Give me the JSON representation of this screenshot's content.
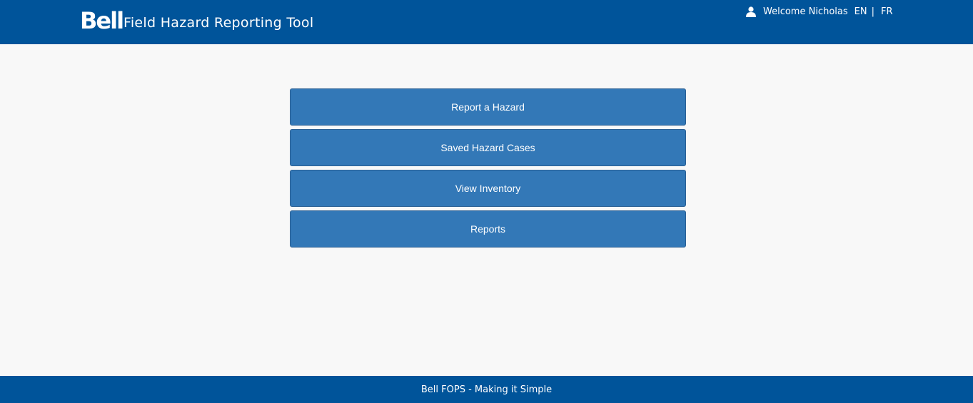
{
  "header": {
    "logo_text": "Bell",
    "app_title": "Field Hazard Reporting Tool",
    "user_icon": "user-icon",
    "welcome_text": "Welcome Nicholas",
    "lang_en": "EN",
    "lang_separator": "|",
    "lang_fr": "FR",
    "background_color": "#00549a"
  },
  "menu": {
    "items": [
      {
        "label": "Report a Hazard"
      },
      {
        "label": "Saved Hazard Cases"
      },
      {
        "label": "View Inventory"
      },
      {
        "label": "Reports"
      }
    ],
    "button_color": "#3378b7"
  },
  "footer": {
    "text": "Bell FOPS - Making it Simple"
  }
}
